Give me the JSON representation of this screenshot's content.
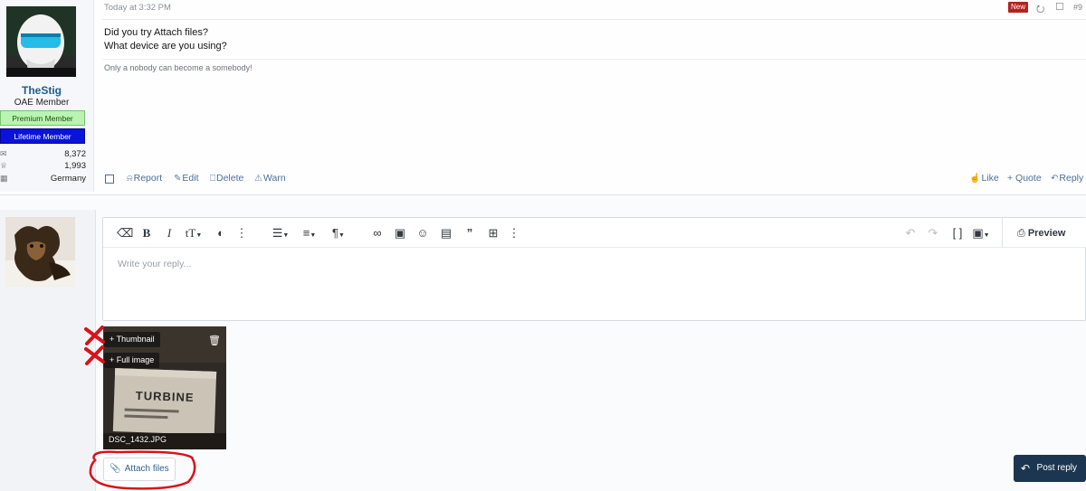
{
  "post": {
    "date": "Today at 3:32 PM",
    "badge": "New",
    "number": "#9",
    "message_lines": [
      "Did you try Attach files?",
      "What device are you using?"
    ],
    "signature": "Only a nobody can become a somebody!",
    "author": {
      "username": "TheStig",
      "title": "OAE Member",
      "banners": [
        "Premium Member",
        "Lifetime Member"
      ],
      "stats": [
        {
          "icon": "messages-icon",
          "value": "8,372"
        },
        {
          "icon": "trophy-icon",
          "value": "1,993"
        },
        {
          "icon": "location-icon",
          "value": "Germany"
        }
      ]
    },
    "actions_left": [
      "Report",
      "Edit",
      "Delete",
      "Warn"
    ],
    "actions_right": [
      "Like",
      "+ Quote",
      "Reply"
    ]
  },
  "reply": {
    "placeholder": "Write your reply...",
    "preview_label": "Preview",
    "attachment": {
      "filename": "DSC_1432.JPG",
      "thumbnail_label": "+ Thumbnail",
      "full_image_label": "+ Full image",
      "photo_text": "TURBINE"
    },
    "attach_files_label": "Attach files",
    "post_reply_label": "Post reply"
  },
  "colors": {
    "accent": "#1c3652",
    "link": "#4a6e96",
    "badge_new": "#b5221d",
    "premium": "#b9f4b0",
    "lifetime": "#0a14d8",
    "annotation": "#d8131b"
  }
}
